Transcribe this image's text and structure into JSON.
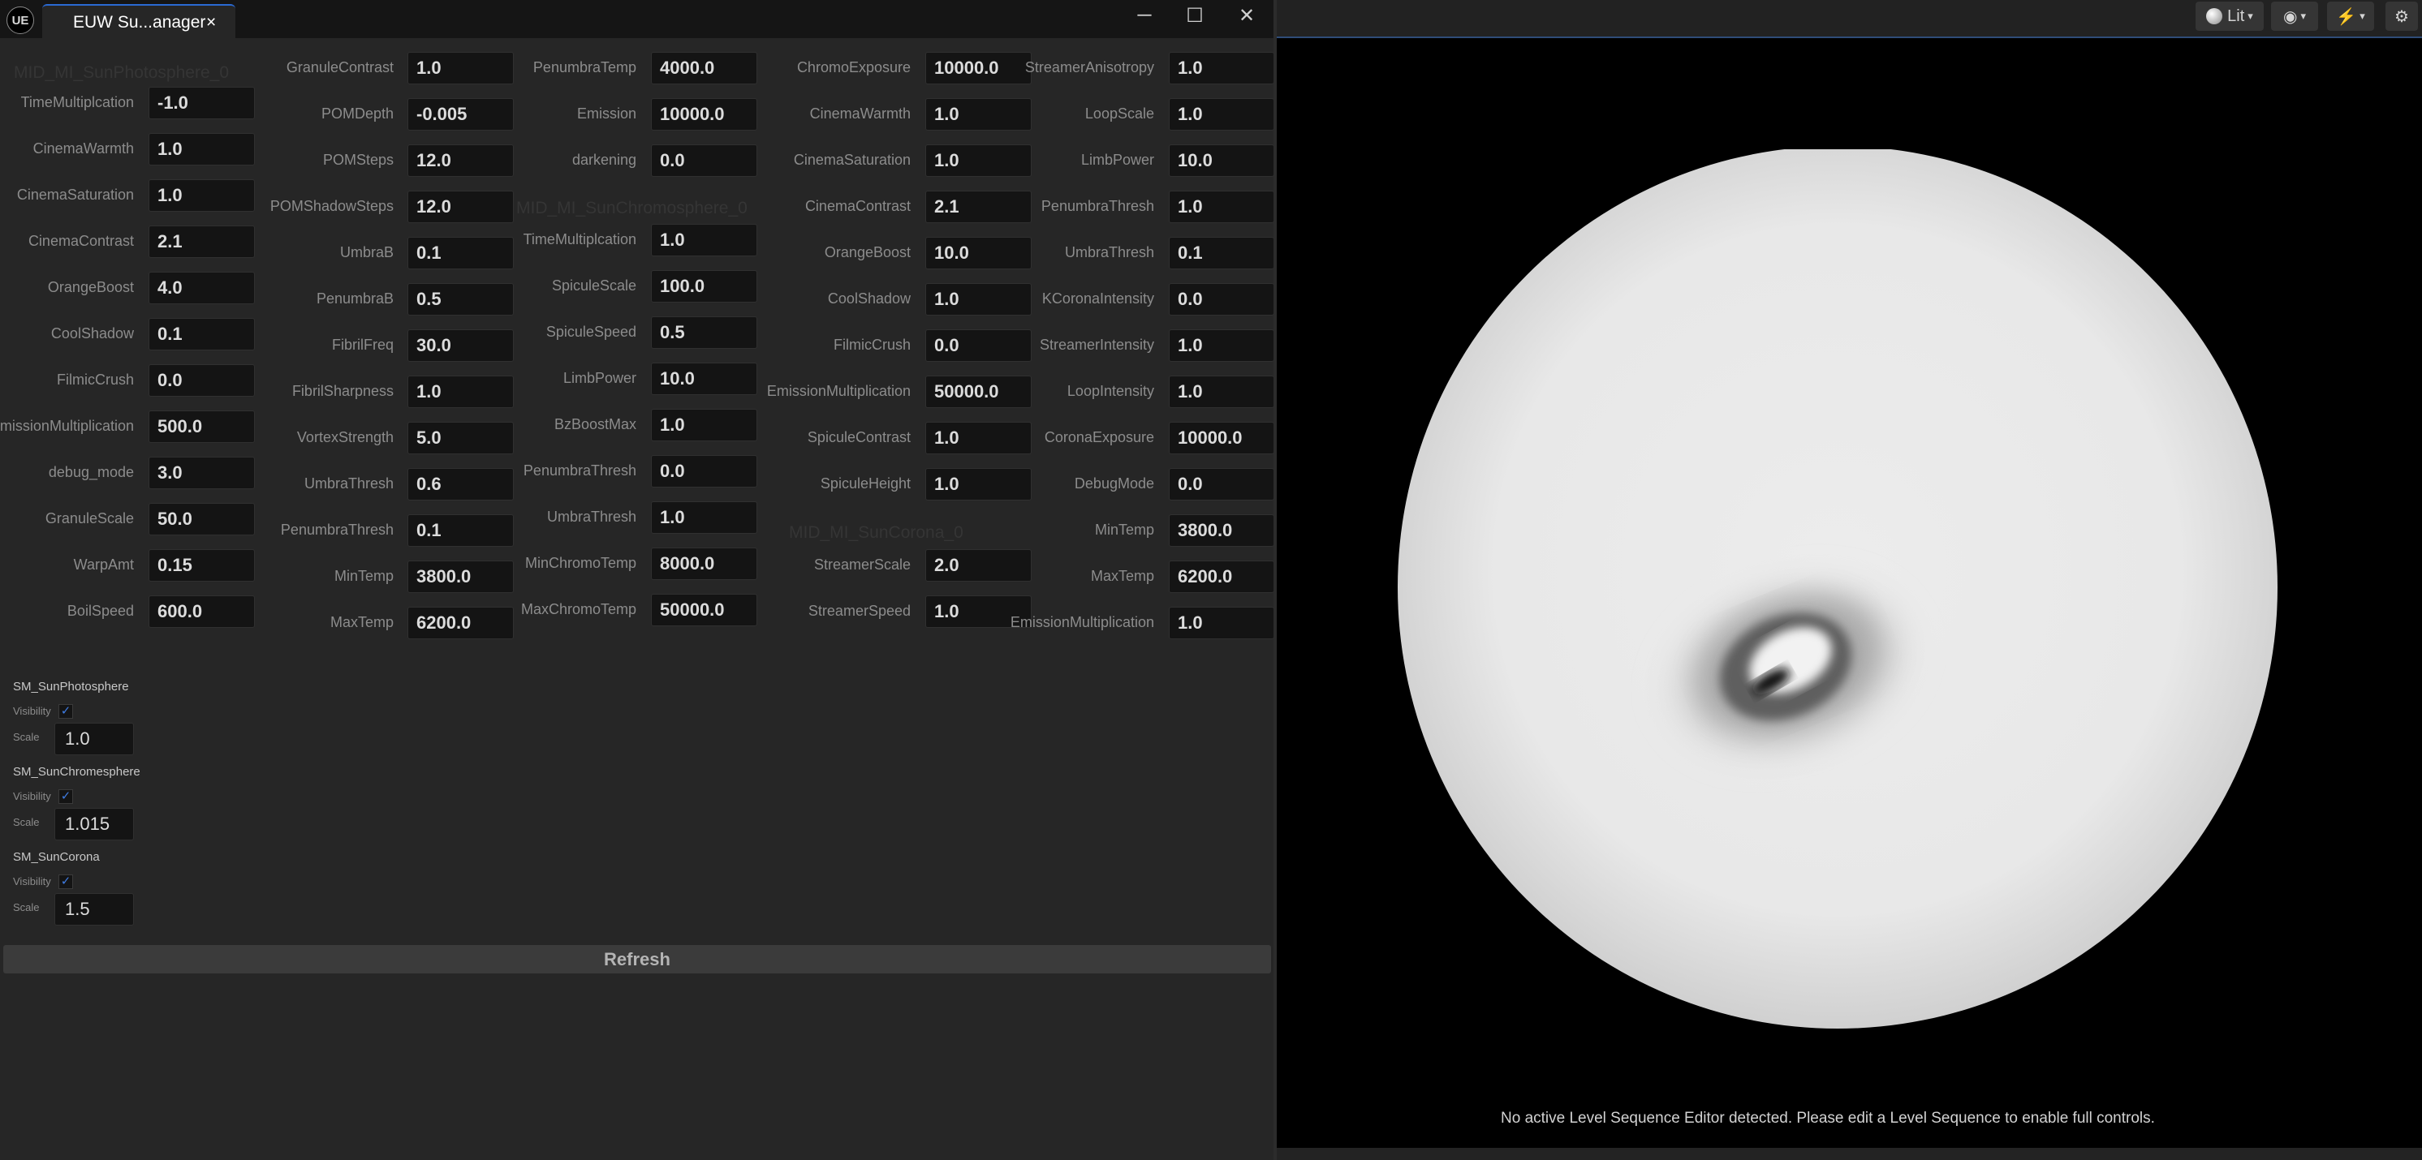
{
  "window": {
    "tab_title": "EUW Su...anager",
    "tab_close": "×",
    "logo": "UE",
    "minimize_glyph": "─",
    "maximize_glyph": "☐",
    "close_glyph": "✕"
  },
  "columns": [
    {
      "section_title": "MID_MI_SunPhotosphere_0",
      "fields": [
        {
          "label": "TimeMultiplcation",
          "value": "-1.0"
        },
        {
          "label": "CinemaWarmth",
          "value": "1.0"
        },
        {
          "label": "CinemaSaturation",
          "value": "1.0"
        },
        {
          "label": "CinemaContrast",
          "value": "2.1"
        },
        {
          "label": "OrangeBoost",
          "value": "4.0"
        },
        {
          "label": "CoolShadow",
          "value": "0.1"
        },
        {
          "label": "FilmicCrush",
          "value": "0.0"
        },
        {
          "label": "EmissionMultiplication",
          "value": "500.0"
        },
        {
          "label": "debug_mode",
          "value": "3.0"
        },
        {
          "label": "GranuleScale",
          "value": "50.0"
        },
        {
          "label": "WarpAmt",
          "value": "0.15"
        },
        {
          "label": "BoilSpeed",
          "value": "600.0"
        }
      ]
    },
    {
      "fields": [
        {
          "label": "GranuleContrast",
          "value": "1.0"
        },
        {
          "label": "POMDepth",
          "value": "-0.005"
        },
        {
          "label": "POMSteps",
          "value": "12.0"
        },
        {
          "label": "POMShadowSteps",
          "value": "12.0"
        },
        {
          "label": "UmbraB",
          "value": "0.1"
        },
        {
          "label": "PenumbraB",
          "value": "0.5"
        },
        {
          "label": "FibrilFreq",
          "value": "30.0"
        },
        {
          "label": "FibrilSharpness",
          "value": "1.0"
        },
        {
          "label": "VortexStrength",
          "value": "5.0"
        },
        {
          "label": "UmbraThresh",
          "value": "0.6"
        },
        {
          "label": "PenumbraThresh",
          "value": "0.1"
        },
        {
          "label": "MinTemp",
          "value": "3800.0"
        },
        {
          "label": "MaxTemp",
          "value": "6200.0"
        }
      ]
    },
    {
      "section_title": "MID_MI_SunChromosphere_0",
      "fields": [
        {
          "label": "PenumbraTemp",
          "value": "4000.0"
        },
        {
          "label": "Emission",
          "value": "10000.0"
        },
        {
          "label": "darkening",
          "value": "0.0"
        },
        {
          "label": "TimeMultiplcation",
          "value": "1.0"
        },
        {
          "label": "SpiculeScale",
          "value": "100.0"
        },
        {
          "label": "SpiculeSpeed",
          "value": "0.5"
        },
        {
          "label": "LimbPower",
          "value": "10.0"
        },
        {
          "label": "BzBoostMax",
          "value": "1.0"
        },
        {
          "label": "PenumbraThresh",
          "value": "0.0"
        },
        {
          "label": "UmbraThresh",
          "value": "1.0"
        },
        {
          "label": "MinChromoTemp",
          "value": "8000.0"
        },
        {
          "label": "MaxChromoTemp",
          "value": "50000.0"
        }
      ]
    },
    {
      "section_title": "MID_MI_SunCorona_0",
      "fields": [
        {
          "label": "ChromoExposure",
          "value": "10000.0"
        },
        {
          "label": "CinemaWarmth",
          "value": "1.0"
        },
        {
          "label": "CinemaSaturation",
          "value": "1.0"
        },
        {
          "label": "CinemaContrast",
          "value": "2.1"
        },
        {
          "label": "OrangeBoost",
          "value": "10.0"
        },
        {
          "label": "CoolShadow",
          "value": "1.0"
        },
        {
          "label": "FilmicCrush",
          "value": "0.0"
        },
        {
          "label": "EmissionMultiplication",
          "value": "50000.0"
        },
        {
          "label": "SpiculeContrast",
          "value": "1.0"
        },
        {
          "label": "SpiculeHeight",
          "value": "1.0"
        },
        {
          "label": "StreamerScale",
          "value": "2.0"
        },
        {
          "label": "StreamerSpeed",
          "value": "1.0"
        }
      ]
    },
    {
      "fields": [
        {
          "label": "StreamerAnisotropy",
          "value": "1.0"
        },
        {
          "label": "LoopScale",
          "value": "1.0"
        },
        {
          "label": "LimbPower",
          "value": "10.0"
        },
        {
          "label": "PenumbraThresh",
          "value": "1.0"
        },
        {
          "label": "UmbraThresh",
          "value": "0.1"
        },
        {
          "label": "KCoronaIntensity",
          "value": "0.0"
        },
        {
          "label": "StreamerIntensity",
          "value": "1.0"
        },
        {
          "label": "LoopIntensity",
          "value": "1.0"
        },
        {
          "label": "CoronaExposure",
          "value": "10000.0"
        },
        {
          "label": "DebugMode",
          "value": "0.0"
        },
        {
          "label": "MinTemp",
          "value": "3800.0"
        },
        {
          "label": "MaxTemp",
          "value": "6200.0"
        },
        {
          "label": "EmissionMultiplication",
          "value": "1.0"
        }
      ]
    }
  ],
  "meshes": [
    {
      "name": "SM_SunPhotosphere",
      "visibility_label": "Visibility",
      "visible": true,
      "scale_label": "Scale",
      "scale": "1.0"
    },
    {
      "name": "SM_SunChromesphere",
      "visibility_label": "Visibility",
      "visible": true,
      "scale_label": "Scale",
      "scale": "1.015"
    },
    {
      "name": "SM_SunCorona",
      "visibility_label": "Visibility",
      "visible": true,
      "scale_label": "Scale",
      "scale": "1.5"
    }
  ],
  "refresh_label": "Refresh",
  "viewport": {
    "view_mode": "Lit",
    "message": "No active Level Sequence Editor detected. Please edit a Level Sequence to enable full controls.",
    "icons": [
      "lit-sphere-icon",
      "eye-icon",
      "camera-speed-icon",
      "gear-icon"
    ]
  }
}
